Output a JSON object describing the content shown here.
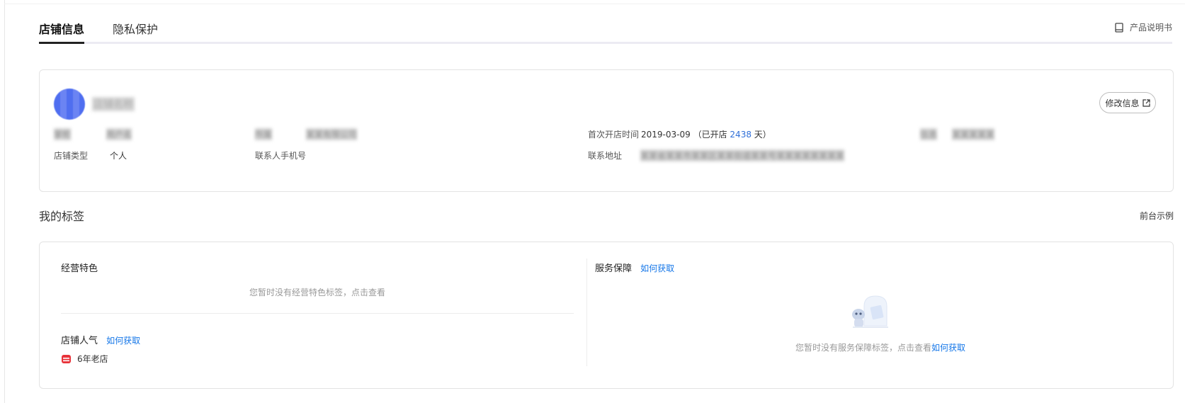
{
  "tabs": [
    {
      "label": "店铺信息",
      "active": true
    },
    {
      "label": "隐私保护",
      "active": false
    }
  ],
  "header": {
    "manual_label": "产品说明书",
    "manual_icon": "book-icon"
  },
  "store": {
    "name": "店铺名称",
    "edit_label": "修改信息",
    "edit_icon": "external-link-icon",
    "fields": {
      "owner_label": "掌柜",
      "owner_value": "用户名",
      "company_label": "所属",
      "company_value": "某某有限公司",
      "open_label": "首次开店时间",
      "open_date": "2019-03-09",
      "open_prefix": "（已开店",
      "open_days": "2438",
      "open_suffix": "天）",
      "extra_label": "信息",
      "extra_value": "某某某某某",
      "type_label": "店铺类型",
      "type_value": "个人",
      "phone_label": "联系人手机号",
      "address_label": "联系地址",
      "address_value": "某某省某某市某某区某某街道某某号某某某某某某某某"
    }
  },
  "tags_section": {
    "title": "我的标签",
    "preview_label": "前台示例",
    "feature": {
      "title": "经营特色",
      "empty": "您暂时没有经营特色标签，点击查看"
    },
    "popularity": {
      "title": "店铺人气",
      "how_label": "如何获取",
      "badge_label": "6年老店",
      "badge_icon": "store-icon"
    },
    "service": {
      "title": "服务保障",
      "how_label": "如何获取",
      "empty_text": "您暂时没有服务保障标签，点击查看",
      "empty_link": "如何获取",
      "illustration": "robot-illustration"
    }
  },
  "colors": {
    "accent": "#1677e8",
    "badge_red": "#e8333a",
    "avatar": "#4f6ef0"
  }
}
